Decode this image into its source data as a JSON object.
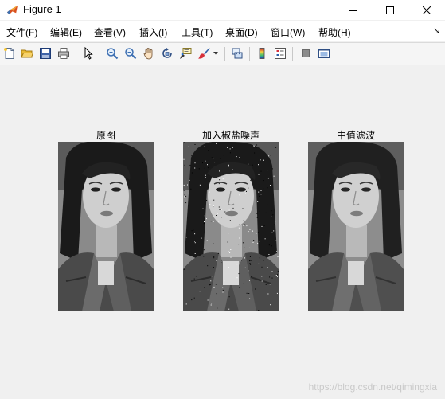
{
  "window": {
    "title": "Figure 1",
    "controls": [
      "minimize",
      "maximize",
      "close"
    ]
  },
  "menubar": {
    "items": [
      {
        "label": "文件(F)"
      },
      {
        "label": "编辑(E)"
      },
      {
        "label": "查看(V)"
      },
      {
        "label": "插入(I)"
      },
      {
        "label": "工具(T)"
      },
      {
        "label": "桌面(D)"
      },
      {
        "label": "窗口(W)"
      },
      {
        "label": "帮助(H)"
      }
    ],
    "overflow_glyph": "↘"
  },
  "toolbar": {
    "buttons": [
      {
        "icon": "new-figure-icon"
      },
      {
        "icon": "open-file-icon"
      },
      {
        "icon": "save-icon"
      },
      {
        "icon": "print-icon"
      },
      {
        "icon": "edit-plot-arrow-icon"
      },
      {
        "icon": "zoom-in-icon"
      },
      {
        "icon": "zoom-out-icon"
      },
      {
        "icon": "pan-hand-icon"
      },
      {
        "icon": "rotate-3d-icon"
      },
      {
        "icon": "data-cursor-icon"
      },
      {
        "icon": "brush-icon"
      },
      {
        "icon": "link-plot-icon"
      },
      {
        "icon": "colorbar-icon"
      },
      {
        "icon": "legend-icon"
      },
      {
        "icon": "hide-plot-tools-icon"
      },
      {
        "icon": "show-plot-tools-icon"
      }
    ]
  },
  "subplots": [
    {
      "title": "原图",
      "variant": "original"
    },
    {
      "title": "加入椒盐噪声",
      "variant": "salt-pepper-noise"
    },
    {
      "title": "中值滤波",
      "variant": "median-filtered"
    }
  ],
  "watermark": "https://blog.csdn.net/qimingxia",
  "colors": {
    "window_bg": "#f0f0f0",
    "menubar_bg": "#ffffff",
    "toolbar_bg": "#f5f5f5"
  }
}
